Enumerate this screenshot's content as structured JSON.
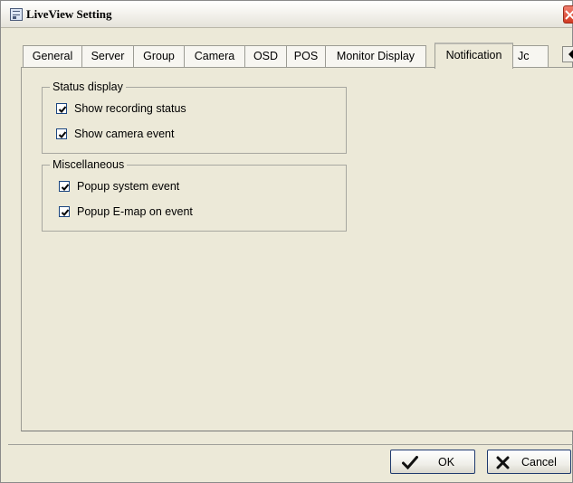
{
  "window": {
    "title": "LiveView Setting"
  },
  "tabs": [
    {
      "label": "General"
    },
    {
      "label": "Server"
    },
    {
      "label": "Group"
    },
    {
      "label": "Camera"
    },
    {
      "label": "OSD"
    },
    {
      "label": "POS"
    },
    {
      "label": "Monitor Display"
    },
    {
      "label": "Notification",
      "active": true
    },
    {
      "label": "Jc"
    }
  ],
  "status_display": {
    "title": "Status display",
    "options": [
      {
        "label": "Show recording status",
        "checked": true
      },
      {
        "label": "Show camera event",
        "checked": true
      }
    ]
  },
  "miscellaneous": {
    "title": "Miscellaneous",
    "options": [
      {
        "label": "Popup system event",
        "checked": true
      },
      {
        "label": "Popup E-map on event",
        "checked": true
      }
    ]
  },
  "buttons": {
    "ok_label": "OK",
    "cancel_label": "Cancel"
  },
  "icons": {
    "title": "window-icon",
    "close": "close-icon",
    "scroll_left": "arrow-left-icon",
    "scroll_right": "arrow-right-icon",
    "ok": "check-icon",
    "cancel": "x-icon"
  }
}
